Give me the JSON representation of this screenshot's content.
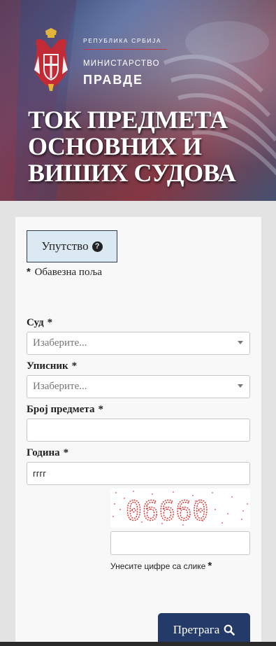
{
  "header": {
    "republic_label": "РЕПУБЛИКА СРБИЈА",
    "ministry_label": "МИНИСТАРСТВО",
    "ministry_name": "ПРАВДЕ",
    "title_lines": [
      "ТОК ПРЕДМЕТА",
      "ОСНОВНИХ И",
      "ВИШИХ СУДОВА"
    ]
  },
  "form": {
    "help_button_label": "Упутство",
    "required_star": "*",
    "required_note": "Обавезна поља",
    "court": {
      "label": "Суд",
      "star": "*",
      "selected": "Изаберите..."
    },
    "registry": {
      "label": "Уписник",
      "star": "*",
      "selected": "Изаберите..."
    },
    "case_number": {
      "label": "Број предмета",
      "star": "*",
      "value": ""
    },
    "year": {
      "label": "Година",
      "star": "*",
      "value": "гггг"
    },
    "captcha": {
      "image_text": "06660",
      "value": "",
      "hint": "Унесите цифре са слике",
      "star": "*"
    },
    "search_button_label": "Претрага"
  },
  "colors": {
    "primary": "#243a68",
    "help_button_bg": "#dbe9f2",
    "accent_red": "#c0374a",
    "captcha_red": "#d93a3a"
  },
  "icons": {
    "help": "question-circle-icon",
    "search": "magnifier-icon",
    "dropdown": "caret-down-icon",
    "logo": "serbian-coat-of-arms"
  }
}
